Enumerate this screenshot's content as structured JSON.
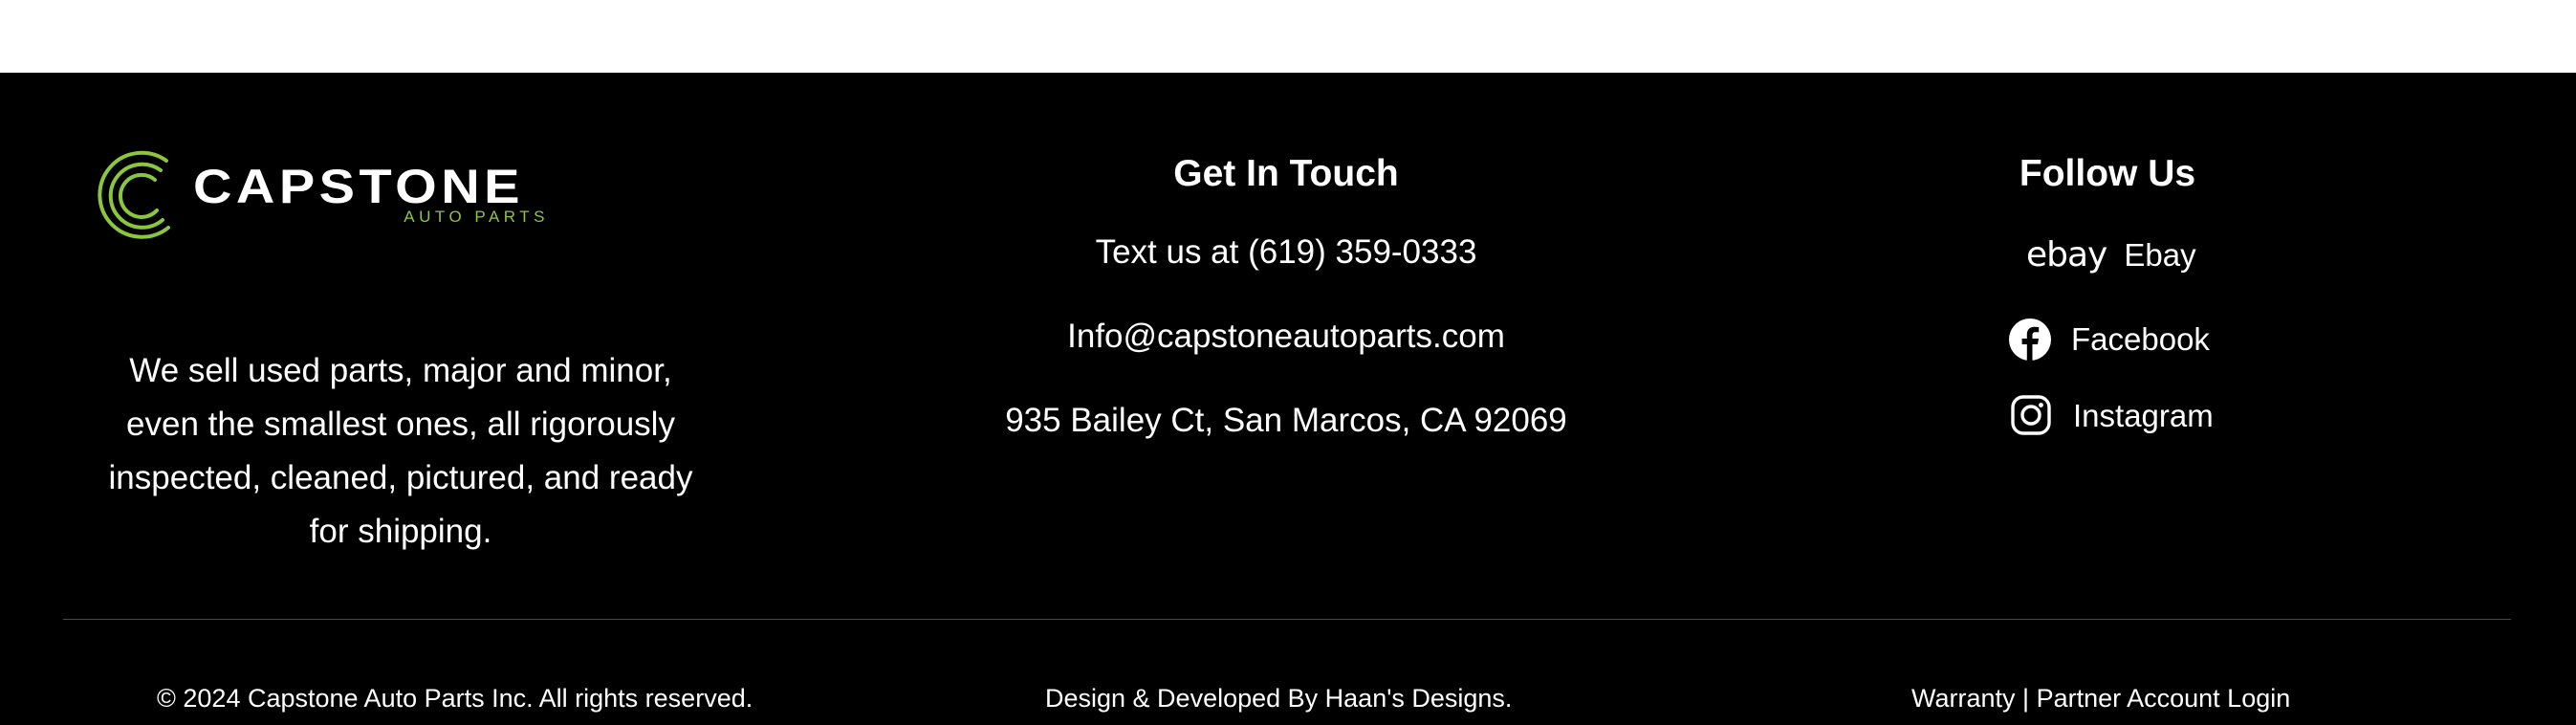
{
  "brand": {
    "logo_name": "CAPSTONE",
    "logo_sub": "AUTO PARTS",
    "description": "We sell used parts, major and minor, even the smallest ones, all rigorously inspected, cleaned, pictured, and ready for shipping.",
    "accent_color": "#8cc63f"
  },
  "contact": {
    "heading": "Get In Touch",
    "phone": "Text us at (619) 359-0333",
    "email": "Info@capstoneautoparts.com",
    "address": "935 Bailey Ct, San Marcos, CA 92069"
  },
  "social": {
    "heading": "Follow Us",
    "items": [
      {
        "label": "Ebay",
        "icon": "ebay-icon",
        "icon_text": "ebay"
      },
      {
        "label": "Facebook",
        "icon": "facebook-icon"
      },
      {
        "label": "Instagram",
        "icon": "instagram-icon"
      }
    ]
  },
  "bottom_bar": {
    "copyright": "© 2024 Capstone Auto Parts Inc. All rights reserved.",
    "credit": "Design & Developed By Haan's Designs.",
    "warranty": "Warranty",
    "separator": "|",
    "partner_login": "Partner Account Login"
  },
  "colors": {
    "background": "#000000",
    "text": "#ffffff",
    "divider": "#454854"
  }
}
